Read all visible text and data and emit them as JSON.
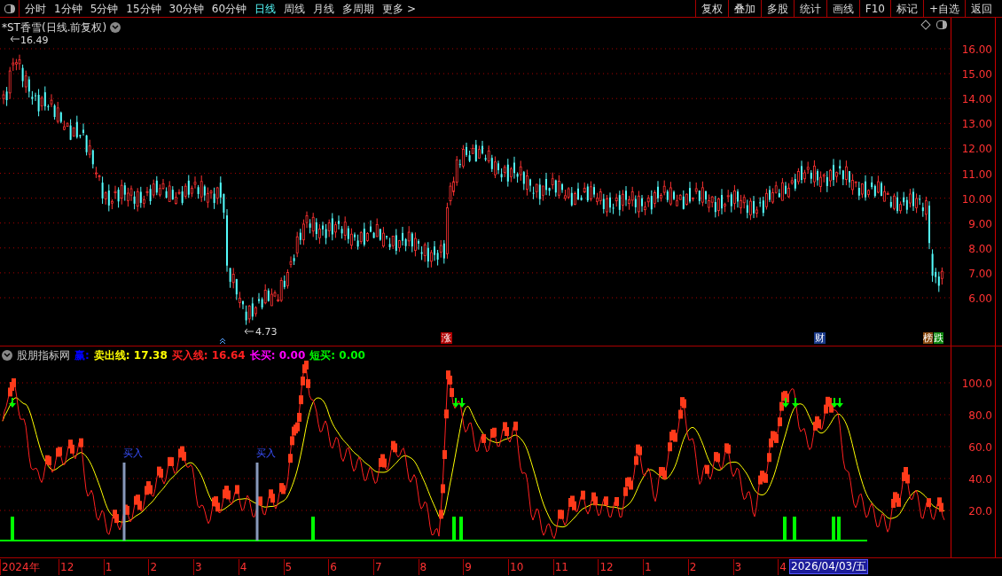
{
  "toolbar": {
    "periods": [
      {
        "label": "分时",
        "selected": false
      },
      {
        "label": "1分钟",
        "selected": false
      },
      {
        "label": "5分钟",
        "selected": false
      },
      {
        "label": "15分钟",
        "selected": false
      },
      {
        "label": "30分钟",
        "selected": false
      },
      {
        "label": "60分钟",
        "selected": false
      },
      {
        "label": "日线",
        "selected": true
      },
      {
        "label": "周线",
        "selected": false
      },
      {
        "label": "月线",
        "selected": false
      },
      {
        "label": "多周期",
        "selected": false
      },
      {
        "label": "更多 >",
        "selected": false
      }
    ],
    "buttons": [
      "复权",
      "叠加",
      "多股",
      "统计",
      "画线",
      "F10",
      "标记",
      "+自选",
      "返回"
    ]
  },
  "price_chart": {
    "title": "*ST香雪(日线.前复权)",
    "high_label": "16.49",
    "low_label": "4.73",
    "y_ticks": [
      "16.00",
      "15.00",
      "14.00",
      "13.00",
      "12.00",
      "11.00",
      "10.00",
      "9.00",
      "8.00",
      "7.00",
      "6.00"
    ],
    "markers": [
      {
        "label": "涨",
        "color": "#b00000"
      },
      {
        "label": "财",
        "color": "#1a3a8a"
      },
      {
        "label": "榜",
        "color": "#8a4a10"
      },
      {
        "label": "跌",
        "color": "#108a10"
      }
    ]
  },
  "indicator": {
    "name": "股朋指标网",
    "legend": [
      {
        "label": "赢:",
        "color": "#0000ff"
      },
      {
        "label": "卖出线:",
        "value": "17.38",
        "color": "#ffff00"
      },
      {
        "label": "买入线:",
        "value": "16.64",
        "color": "#ff2020"
      },
      {
        "label": "长买:",
        "value": "0.00",
        "color": "#ff00ff"
      },
      {
        "label": "短买:",
        "value": "0.00",
        "color": "#00ff00"
      }
    ],
    "y_ticks": [
      "100.0",
      "80.0",
      "60.0",
      "40.0",
      "20.0"
    ],
    "buy_labels": [
      "买入",
      "买入"
    ]
  },
  "time_axis": {
    "labels": [
      "2024年",
      "12",
      "1",
      "2",
      "3",
      "4",
      "5",
      "6",
      "7",
      "8",
      "9",
      "10",
      "11",
      "12",
      "1",
      "2",
      "3",
      "4"
    ],
    "cursor_date": "2026/04/03/五"
  }
}
